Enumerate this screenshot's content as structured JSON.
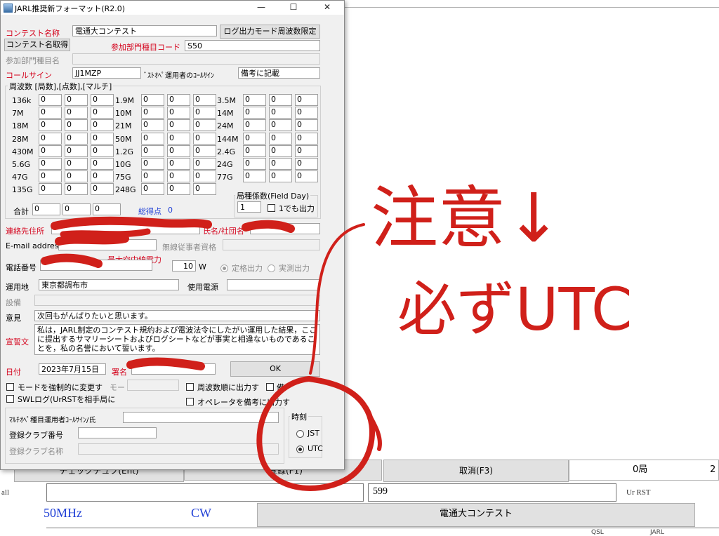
{
  "window": {
    "title": "JARL推奨新フォーマット(R2.0)",
    "minimize": "—",
    "maximize": "☐",
    "close": "✕"
  },
  "contest": {
    "name_label": "コンテスト名称",
    "name_value": "電通大コンテスト",
    "log_mode_button": "ログ出力モード周波数限定",
    "get_name_button": "コンテスト名取得",
    "category_code_label": "参加部門種目コード",
    "category_code_value": "S50",
    "category_name_label": "参加部門種目名",
    "callsign_label": "コールサイン",
    "callsign_value": "JJ1MZP",
    "operator_label": "ﾞｽﾄｵﾍﾟ運用者のｺｰﾙｻｲﾝ",
    "operator_value": "備考に記載"
  },
  "bands": {
    "group_label": "周波数 [局数],[点数],[マルチ]",
    "col1": [
      {
        "name": "136k",
        "qso": "0",
        "pts": "0",
        "mult": "0"
      },
      {
        "name": "7M",
        "qso": "0",
        "pts": "0",
        "mult": "0"
      },
      {
        "name": "18M",
        "qso": "0",
        "pts": "0",
        "mult": "0"
      },
      {
        "name": "28M",
        "qso": "0",
        "pts": "0",
        "mult": "0"
      },
      {
        "name": "430M",
        "qso": "0",
        "pts": "0",
        "mult": "0"
      },
      {
        "name": "5.6G",
        "qso": "0",
        "pts": "0",
        "mult": "0"
      },
      {
        "name": "47G",
        "qso": "0",
        "pts": "0",
        "mult": "0"
      },
      {
        "name": "135G",
        "qso": "0",
        "pts": "0",
        "mult": "0"
      }
    ],
    "col2": [
      {
        "name": "1.9M",
        "qso": "0",
        "pts": "0",
        "mult": "0"
      },
      {
        "name": "10M",
        "qso": "0",
        "pts": "0",
        "mult": "0"
      },
      {
        "name": "21M",
        "qso": "0",
        "pts": "0",
        "mult": "0"
      },
      {
        "name": "50M",
        "qso": "0",
        "pts": "0",
        "mult": "0"
      },
      {
        "name": "1.2G",
        "qso": "0",
        "pts": "0",
        "mult": "0"
      },
      {
        "name": "10G",
        "qso": "0",
        "pts": "0",
        "mult": "0"
      },
      {
        "name": "75G",
        "qso": "0",
        "pts": "0",
        "mult": "0"
      },
      {
        "name": "248G",
        "qso": "0",
        "pts": "0",
        "mult": "0"
      }
    ],
    "col3": [
      {
        "name": "3.5M",
        "qso": "0",
        "pts": "0",
        "mult": "0"
      },
      {
        "name": "14M",
        "qso": "0",
        "pts": "0",
        "mult": "0"
      },
      {
        "name": "24M",
        "qso": "0",
        "pts": "0",
        "mult": "0"
      },
      {
        "name": "144M",
        "qso": "0",
        "pts": "0",
        "mult": "0"
      },
      {
        "name": "2.4G",
        "qso": "0",
        "pts": "0",
        "mult": "0"
      },
      {
        "name": "24G",
        "qso": "0",
        "pts": "0",
        "mult": "0"
      },
      {
        "name": "77G",
        "qso": "0",
        "pts": "0",
        "mult": "0"
      }
    ],
    "total_label": "合計",
    "total_qso": "0",
    "total_pts": "0",
    "total_mult": "0",
    "score_label": "総得点",
    "score_value": "0",
    "coef_group_label": "局種係数(Field Day)",
    "coef_value": "1",
    "coef_checkbox": "1でも出力"
  },
  "contact": {
    "address_label": "連絡先住所",
    "club_name_label": "氏名/社団名",
    "email_label": "E-mail address",
    "license_label": "無線従事者資格",
    "phone_label": "電話番号",
    "max_power_label": "最大空中線電力",
    "power_value": "10",
    "power_unit": "W",
    "rated_output": "定格出力",
    "measured_output": "実測出力",
    "qth_label": "運用地",
    "qth_value": "東京都調布市",
    "power_source_label": "使用電源",
    "equipment_label": "設備",
    "opinion_label": "意見",
    "opinion_value": "次回もがんばりたいと思います。",
    "oath_label": "宣誓文",
    "oath_value": "私は，JARL制定のコンテスト規約および電波法令にしたがい運用した結果，ここに提出するサマリーシートおよびログシートなどが事実と相違ないものであることを，私の名誉において誓います。",
    "date_label": "日付",
    "date_value": "2023年7月15日",
    "signature_label": "署名",
    "ok_button": "OK"
  },
  "options": {
    "force_mode": "モードを強制的に変更す",
    "mode_label": "モー",
    "freq_order": "周波数順に出力す",
    "remarks": "備",
    "swl_log": "SWLログ(UrRSTを相手局に",
    "operator_remarks": "オペレータを備考に出力す",
    "multi_op_label": "ﾏﾙﾁｵﾍﾟ種目運用者ｺｰﾙｻｲﾝ/氏",
    "club_no_label": "登録クラブ番号",
    "club_name_label": "登録クラブ名称",
    "time_group_label": "時刻",
    "jst": "JST",
    "utc": "UTC"
  },
  "main_window": {
    "dupe_check_button": "チェックデュプ(Ent)",
    "register_button": "登録(F1)",
    "cancel_button": "取消(F3)",
    "station_count": "0局",
    "left_label": "all",
    "rst_label": "Ur RST",
    "rst_value": "599",
    "band_display": "50MHz",
    "mode_display": "CW",
    "contest_display": "電通大コンテスト",
    "col_header_qsl": "QSL",
    "col_header_jarl": "JARL"
  },
  "annotation": {
    "text_line1": "注意↓",
    "text_line2": "必ずUTC",
    "ink_color": "#d0201a"
  },
  "colors": {
    "dialog_bg": "#f0f0f0",
    "red_label": "#d4001a",
    "blue_label": "#1f3fd6"
  }
}
